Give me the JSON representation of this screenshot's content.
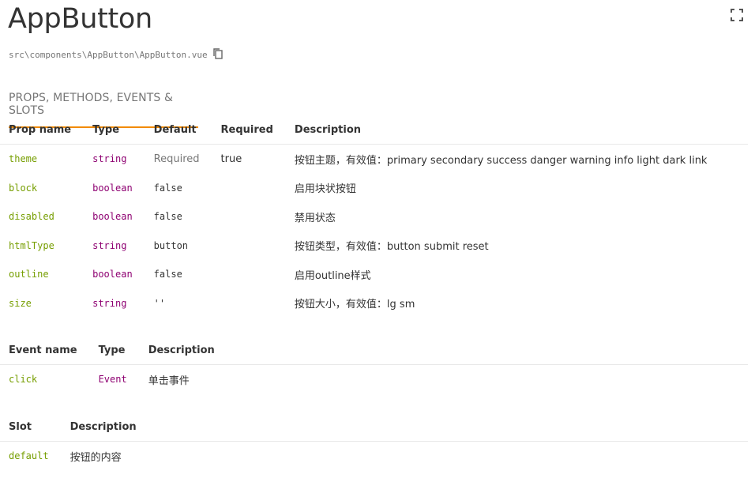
{
  "title": "AppButton",
  "path": "src\\components\\AppButton\\AppButton.vue",
  "tab_label": "PROPS, METHODS, EVENTS & SLOTS",
  "props_table": {
    "headers": [
      "Prop name",
      "Type",
      "Default",
      "Required",
      "Description"
    ],
    "rows": [
      {
        "name": "theme",
        "type": "string",
        "default": "Required",
        "required": "true",
        "description": "按钮主题，有效值：primary secondary success danger warning info light dark link"
      },
      {
        "name": "block",
        "type": "boolean",
        "default": "false",
        "required": "",
        "description": "启用块状按钮"
      },
      {
        "name": "disabled",
        "type": "boolean",
        "default": "false",
        "required": "",
        "description": "禁用状态"
      },
      {
        "name": "htmlType",
        "type": "string",
        "default": "button",
        "required": "",
        "description": "按钮类型，有效值：button submit reset"
      },
      {
        "name": "outline",
        "type": "boolean",
        "default": "false",
        "required": "",
        "description": "启用outline样式"
      },
      {
        "name": "size",
        "type": "string",
        "default": "''",
        "required": "",
        "description": "按钮大小，有效值：lg sm"
      }
    ]
  },
  "events_table": {
    "headers": [
      "Event name",
      "Type",
      "Description"
    ],
    "rows": [
      {
        "name": "click",
        "type": "Event",
        "description": "单击事件"
      }
    ]
  },
  "slots_table": {
    "headers": [
      "Slot",
      "Description"
    ],
    "rows": [
      {
        "name": "default",
        "description": "按钮的内容"
      }
    ]
  },
  "icons": {
    "expand": "fullscreen-icon",
    "copy": "copy-icon"
  },
  "colors": {
    "accent": "#f28a00",
    "name": "#769e00",
    "type": "#8e0071"
  }
}
